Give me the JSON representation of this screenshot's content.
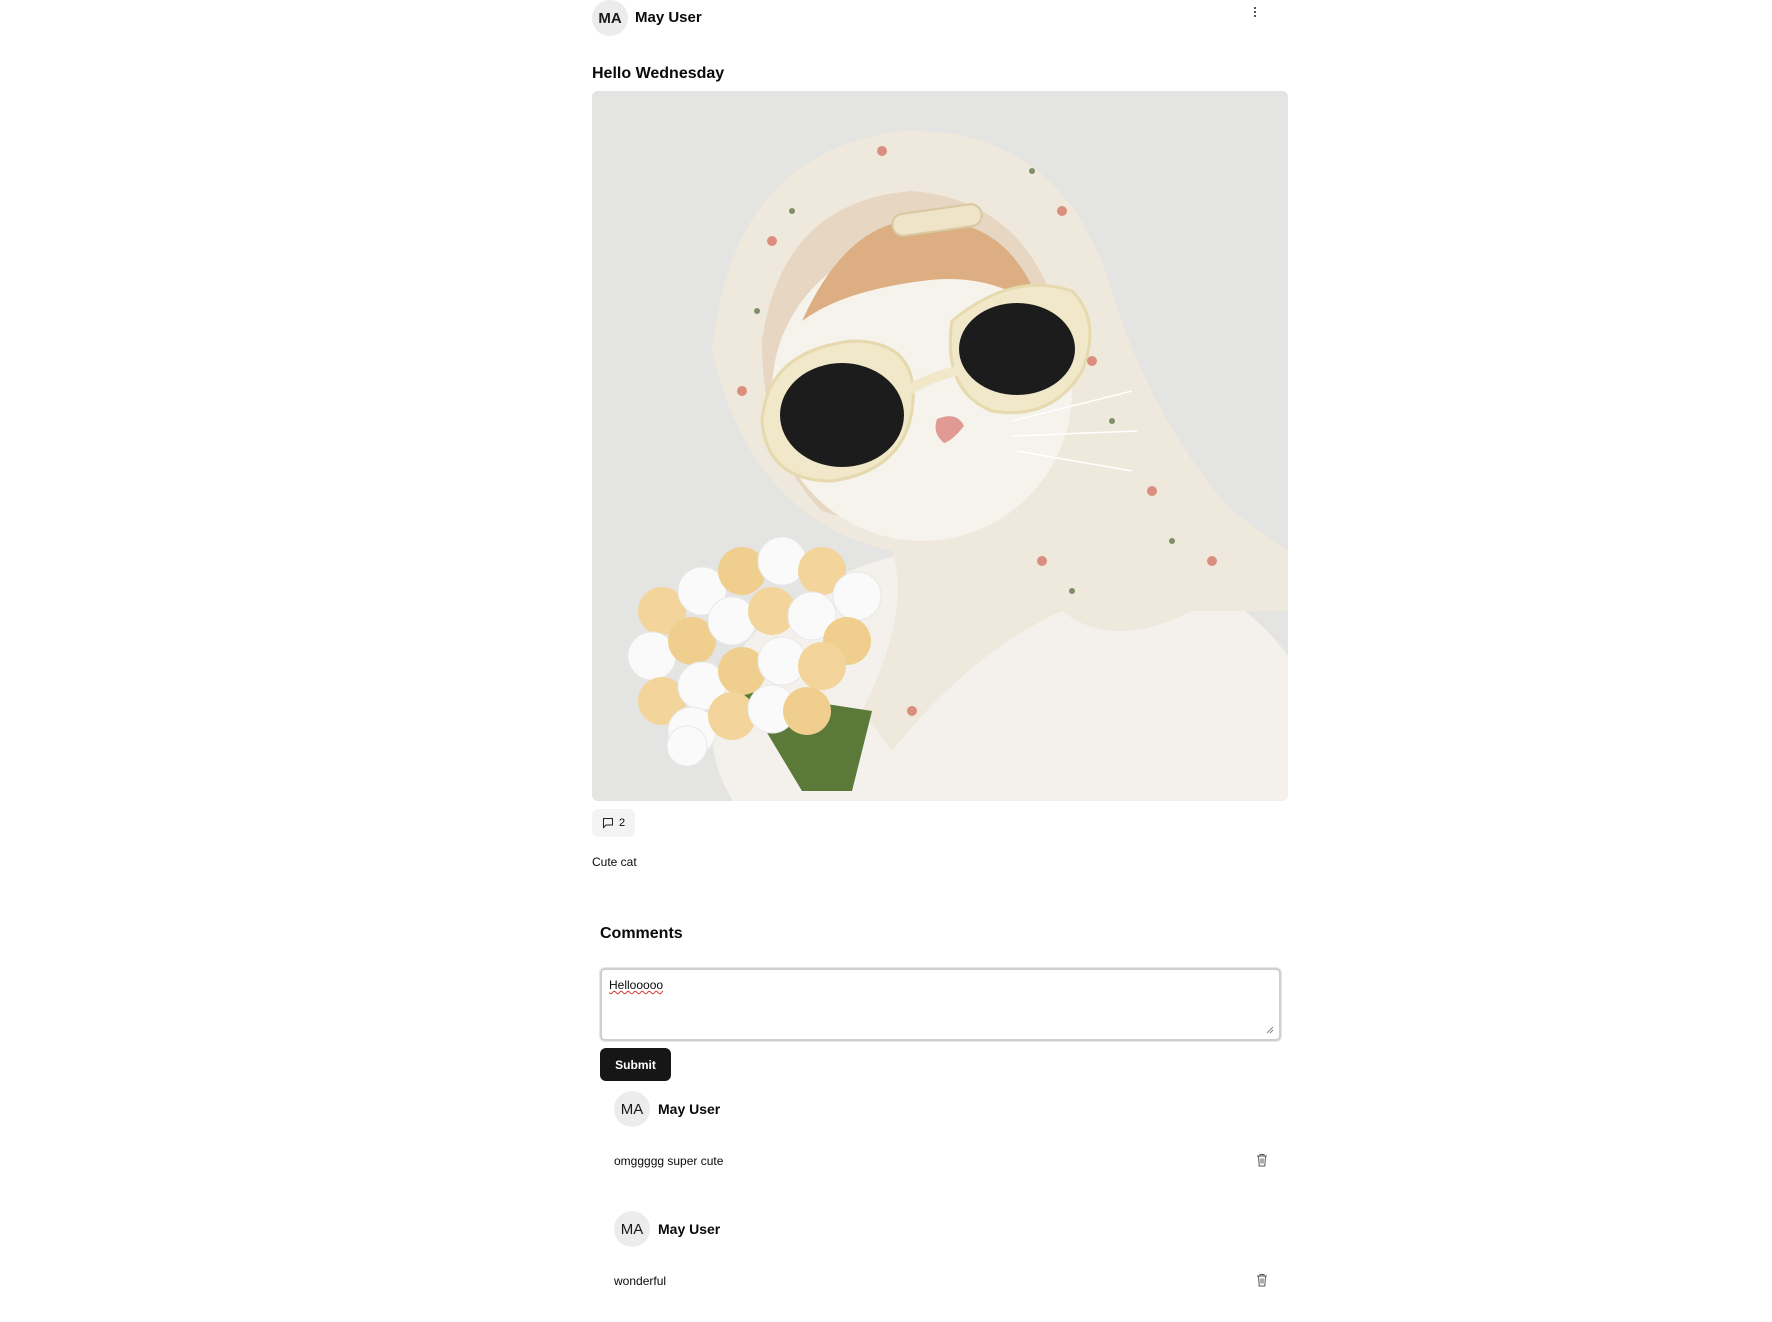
{
  "post": {
    "avatar_initials": "MA",
    "author": "May User",
    "more_icon": "vertical-dots-icon",
    "title": "Hello Wednesday",
    "image_subject": "cat-with-sunglasses-and-floral-headscarf",
    "comment_icon": "message-square-icon",
    "comment_count": "2",
    "caption": "Cute cat"
  },
  "comments_section": {
    "heading": "Comments",
    "input_value": "Hellooooo",
    "submit_label": "Submit",
    "items": [
      {
        "avatar_initials": "MA",
        "author": "May User",
        "text": "omggggg super cute",
        "delete_icon": "trash-icon"
      },
      {
        "avatar_initials": "MA",
        "author": "May User",
        "text": "wonderful",
        "delete_icon": "trash-icon"
      }
    ]
  },
  "colors": {
    "primary_button": "#161616",
    "avatar_bg": "#ececec",
    "chip_bg": "#f3f3f3"
  }
}
